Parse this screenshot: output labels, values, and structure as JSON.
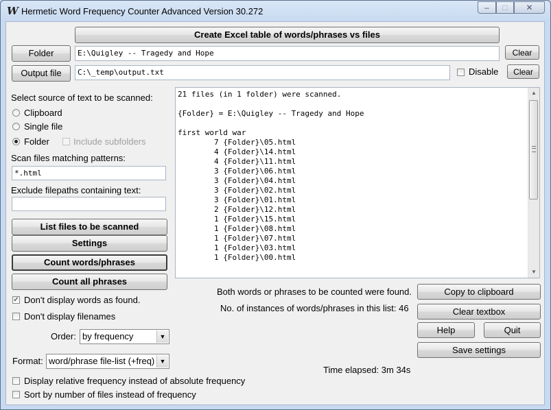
{
  "window": {
    "title": "Hermetic Word Frequency Counter Advanced Version 30.272",
    "app_icon_glyph": "W",
    "minimize_glyph": "–",
    "maximize_glyph": "□",
    "close_glyph": "✕"
  },
  "toolbar": {
    "create_excel_label": "Create Excel table of words/phrases vs files",
    "folder_label": "Folder",
    "folder_value": "E:\\Quigley -- Tragedy and Hope",
    "folder_clear_label": "Clear",
    "output_label": "Output file",
    "output_value": "C:\\_temp\\output.txt",
    "disable_label": "Disable",
    "disable_checked": false,
    "output_clear_label": "Clear"
  },
  "source": {
    "heading": "Select source of text to be scanned:",
    "options": [
      {
        "label": "Clipboard",
        "selected": false
      },
      {
        "label": "Single file",
        "selected": false
      },
      {
        "label": "Folder",
        "selected": true
      }
    ],
    "include_subfolders_label": "Include subfolders",
    "include_subfolders_checked": false
  },
  "filters": {
    "patterns_label": "Scan files matching patterns:",
    "patterns_value": "*.html",
    "exclude_label": "Exclude filepaths containing text:",
    "exclude_value": ""
  },
  "actions": {
    "list_files_label": "List files to be scanned",
    "settings_label": "Settings",
    "count_words_label": "Count words/phrases",
    "count_all_label": "Count all phrases"
  },
  "options": {
    "dont_display_words_label": "Don't display words as found.",
    "dont_display_words_checked": true,
    "dont_display_filenames_label": "Don't display filenames",
    "dont_display_filenames_checked": false,
    "order_label": "Order:",
    "order_value": "by frequency",
    "format_label": "Format:",
    "format_value": "word/phrase file-list (+freq)",
    "relative_freq_label": "Display relative frequency instead of absolute frequency",
    "relative_freq_checked": false,
    "sort_by_files_label": "Sort by number of files instead of frequency",
    "sort_by_files_checked": false
  },
  "output": {
    "lines": [
      "21 files (in 1 folder) were scanned.",
      "",
      "{Folder} = E:\\Quigley -- Tragedy and Hope",
      "",
      "first world war",
      "        7 {Folder}\\05.html",
      "        4 {Folder}\\14.html",
      "        4 {Folder}\\11.html",
      "        3 {Folder}\\06.html",
      "        3 {Folder}\\04.html",
      "        3 {Folder}\\02.html",
      "        3 {Folder}\\01.html",
      "        2 {Folder}\\12.html",
      "        1 {Folder}\\15.html",
      "        1 {Folder}\\08.html",
      "        1 {Folder}\\07.html",
      "        1 {Folder}\\03.html",
      "        1 {Folder}\\00.html"
    ]
  },
  "status": {
    "found_message": "Both words or phrases to be counted were found.",
    "instances_message": "No. of instances of words/phrases in this list: 46",
    "time_elapsed": "Time elapsed: 3m 34s"
  },
  "right_buttons": {
    "copy_label": "Copy to clipboard",
    "clear_textbox_label": "Clear textbox",
    "help_label": "Help",
    "quit_label": "Quit",
    "save_settings_label": "Save settings"
  }
}
